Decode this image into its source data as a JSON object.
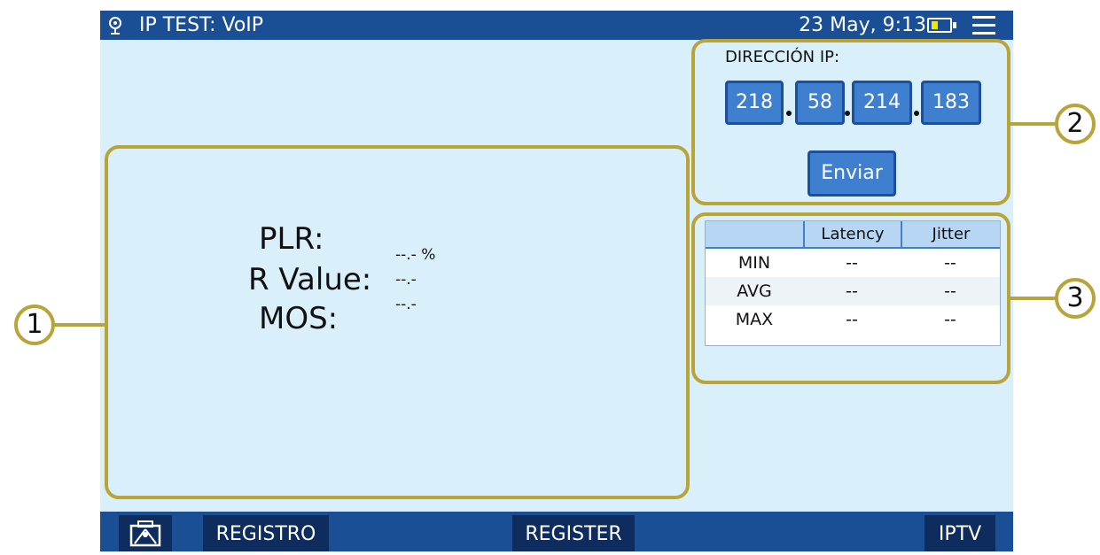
{
  "header": {
    "title": "IP TEST: VoIP",
    "datetime": "23 May, 9:13",
    "battery_level": 0.35
  },
  "callouts": [
    "1",
    "2",
    "3"
  ],
  "results": {
    "plr_label": "PLR:",
    "plr_value": "--.- %",
    "r_value_label": "R Value:",
    "r_value": "--.-",
    "mos_label": "MOS:",
    "mos_value": "--.-"
  },
  "ip_panel": {
    "label": "DIRECCIÓN IP:",
    "octets": [
      "218",
      "58",
      "214",
      "183"
    ],
    "send_label": "Enviar"
  },
  "stats": {
    "columns": [
      "",
      "Latency",
      "Jitter"
    ],
    "rows": [
      {
        "label": "MIN",
        "latency": "--",
        "jitter": "--"
      },
      {
        "label": "AVG",
        "latency": "--",
        "jitter": "--"
      },
      {
        "label": "MAX",
        "latency": "--",
        "jitter": "--"
      }
    ]
  },
  "bottom_bar": {
    "buttons": [
      "REGISTRO",
      "REGISTER",
      "IPTV"
    ]
  },
  "colors": {
    "bar": "#1a4f96",
    "button_dark": "#0e2d5e",
    "field": "#3f7fd0",
    "callout": "#b9a43a",
    "screen_bg": "#d9f0fb",
    "battery_fill": "#f5e400"
  }
}
